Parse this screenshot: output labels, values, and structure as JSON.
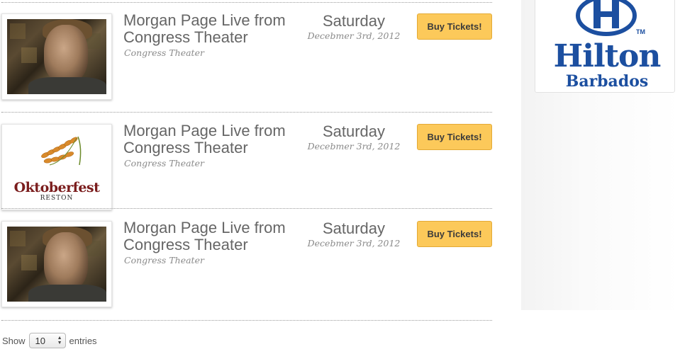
{
  "events": [
    {
      "image": "morgan-page-photo",
      "title": "Morgan Page Live from Congress Theater",
      "venue": "Congress Theater",
      "day": "Saturday",
      "date": "Decebmer 3rd, 2012",
      "button": "Buy Tickets!"
    },
    {
      "image": "oktoberfest-logo",
      "title": "Morgan Page Live from Congress Theater",
      "venue": "Congress Theater",
      "day": "Saturday",
      "date": "Decebmer 3rd, 2012",
      "button": "Buy Tickets!"
    },
    {
      "image": "morgan-page-photo",
      "title": "Morgan Page Live from Congress Theater",
      "venue": "Congress Theater",
      "day": "Saturday",
      "date": "Decebmer 3rd, 2012",
      "button": "Buy Tickets!"
    }
  ],
  "oktoberfest": {
    "name": "Oktoberfest",
    "sub": "RESTON"
  },
  "ad": {
    "brand": "Hilton",
    "location": "Barbados",
    "trademark": "TM",
    "color": "#1c4fa0"
  },
  "pagination": {
    "show_label": "Show",
    "page_size": "10",
    "entries_label": "entries"
  },
  "colors": {
    "button": "#fcc95a",
    "button_border": "#e3aa36"
  }
}
